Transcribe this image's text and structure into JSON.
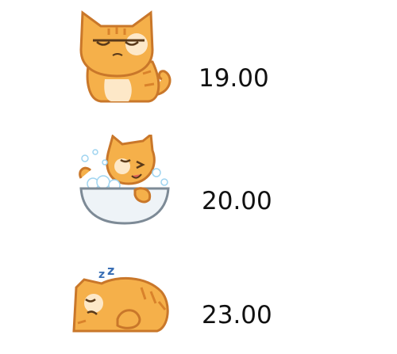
{
  "entries": [
    {
      "time": "19.00",
      "icon": "cat-sitting-grumpy-icon"
    },
    {
      "time": "20.00",
      "icon": "cat-bathing-icon"
    },
    {
      "time": "23.00",
      "icon": "cat-sleeping-icon"
    }
  ],
  "colors": {
    "cat_fill": "#f5b04a",
    "cat_stroke": "#c9772a",
    "stripe": "#d9822b",
    "tub": "#eef3f7",
    "bubbles": "#9fd4f0",
    "zzz": "#3a6fb5"
  }
}
